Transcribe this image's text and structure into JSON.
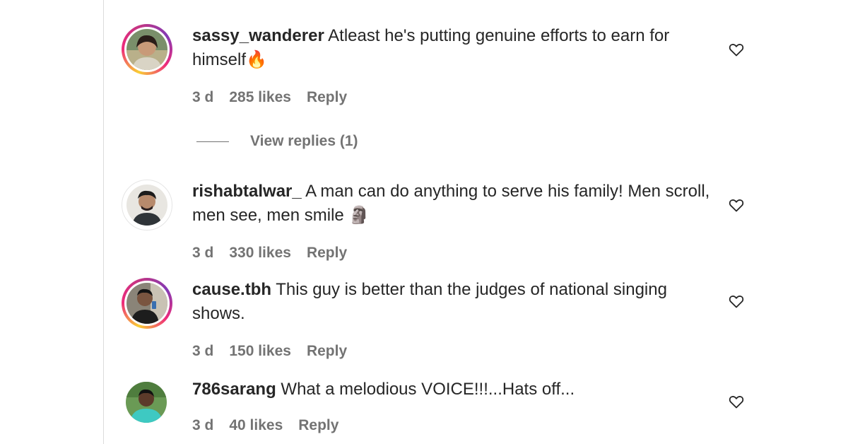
{
  "comments": [
    {
      "username": "sassy_wanderer",
      "text": "Atleast he's putting genuine efforts to earn for himself",
      "emoji": "🔥",
      "time": "3 d",
      "likes": "285 likes",
      "reply_label": "Reply",
      "story_ring": true,
      "icon": "heart-icon"
    },
    {
      "username": "rishabtalwar_",
      "text": "A man can do anything to serve his family! Men scroll, men see, men smile",
      "emoji": "🗿",
      "time": "3 d",
      "likes": "330 likes",
      "reply_label": "Reply",
      "story_ring": false,
      "icon": "heart-icon"
    },
    {
      "username": "cause.tbh",
      "text": "This guy is better than the judges of national singing shows.",
      "emoji": "",
      "time": "3 d",
      "likes": "150 likes",
      "reply_label": "Reply",
      "story_ring": true,
      "icon": "heart-icon"
    },
    {
      "username": "786sarang",
      "text": "What a melodious VOICE!!!...Hats off...",
      "emoji": "",
      "time": "3 d",
      "likes": "40 likes",
      "reply_label": "Reply",
      "story_ring": false,
      "icon": "heart-icon"
    }
  ],
  "view_replies": {
    "label": "View replies (1)"
  },
  "colors": {
    "text": "#262626",
    "secondary": "#737373",
    "story_ring": "#ee2a7b"
  }
}
